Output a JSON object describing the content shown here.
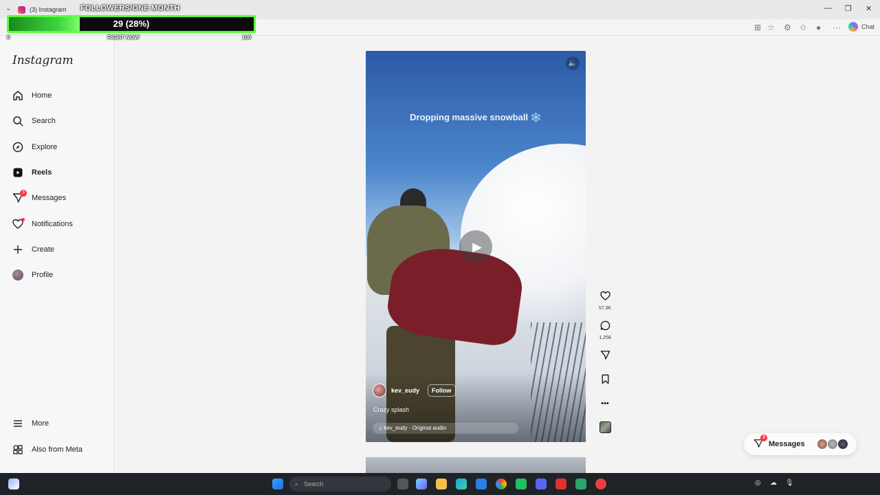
{
  "browser": {
    "tab_title": "(3) Instagram",
    "toolbar": {
      "chat_label": "Chat"
    }
  },
  "overlay": {
    "title": "FOLLOWERS/ONE MONTH",
    "value_text": "29 (28%)",
    "progress_fraction": 0.29,
    "tick_min": "0",
    "tick_mid": "RIGHT NOW",
    "tick_max": "100"
  },
  "sidebar": {
    "logo": "Instagram",
    "items": [
      {
        "label": "Home",
        "icon": "home-icon"
      },
      {
        "label": "Search",
        "icon": "search-icon"
      },
      {
        "label": "Explore",
        "icon": "compass-icon"
      },
      {
        "label": "Reels",
        "icon": "reels-icon"
      },
      {
        "label": "Messages",
        "icon": "messenger-icon",
        "badge": "3"
      },
      {
        "label": "Notifications",
        "icon": "heart-icon"
      },
      {
        "label": "Create",
        "icon": "plus-icon"
      },
      {
        "label": "Profile",
        "icon": "avatar"
      }
    ],
    "more_label": "More",
    "meta_label": "Also from Meta"
  },
  "reel": {
    "overlay_text": "Dropping massive snowball ❄️",
    "author": "kev_eudy",
    "follow_label": "Follow",
    "caption": "Crazy splash",
    "audio": "♫ kev_eudy · Original audio",
    "likes": "57.3K",
    "comments": "1,258"
  },
  "messages": {
    "label": "Messages",
    "badge": "3"
  },
  "taskbar": {
    "search_placeholder": "Search"
  },
  "colors": {
    "overlay_border": "#57ff3a",
    "notification_red": "#ff3040",
    "taskbar_bg": "#1f2226"
  }
}
